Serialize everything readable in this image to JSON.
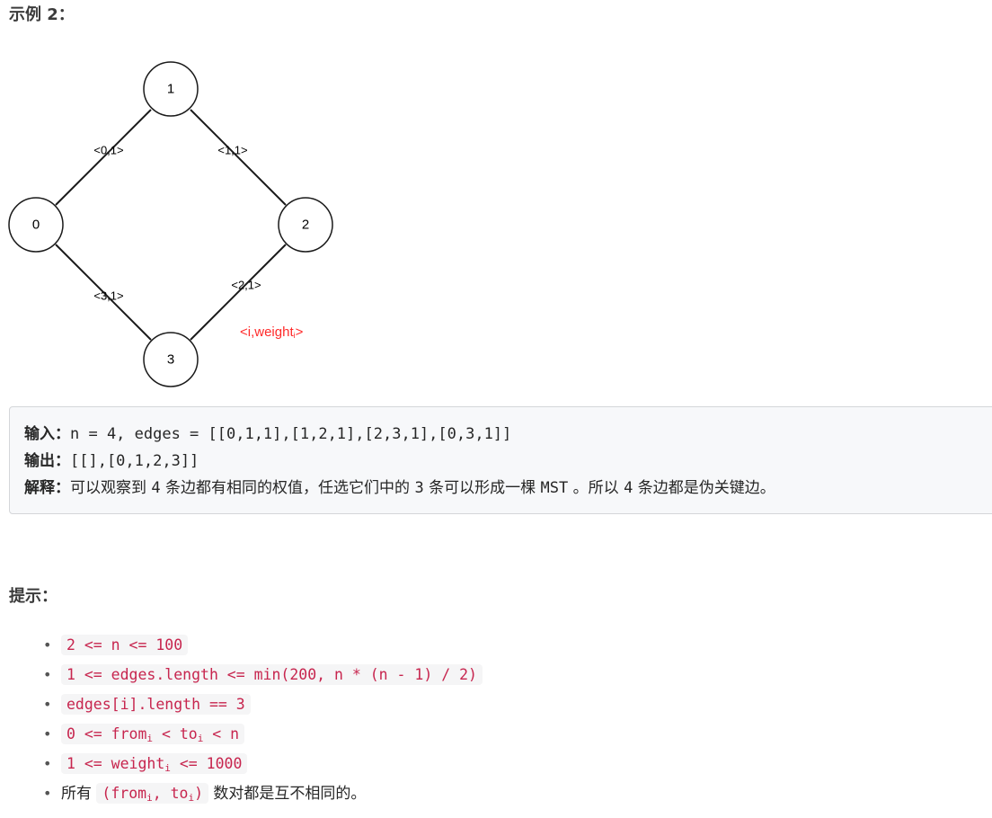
{
  "example_heading": "示例 2：",
  "figure": {
    "nodes": [
      {
        "id": "node-0",
        "label": "0"
      },
      {
        "id": "node-1",
        "label": "1"
      },
      {
        "id": "node-2",
        "label": "2"
      },
      {
        "id": "node-3",
        "label": "3"
      }
    ],
    "edges": [
      {
        "label": "<0,1>"
      },
      {
        "label": "<1,1>"
      },
      {
        "label": "<2,1>"
      },
      {
        "label": "<3,1>"
      }
    ],
    "legend": {
      "prefix": "<i,weight",
      "sub": "i",
      "suffix": ">"
    },
    "legend_color": "#ff2a2a"
  },
  "example": {
    "input_label": "输入：",
    "input_value": "n = 4, edges = [[0,1,1],[1,2,1],[2,3,1],[0,3,1]]",
    "output_label": "输出：",
    "output_value": "[[],[0,1,2,3]]",
    "explanation_label": "解释：",
    "explanation_parts": [
      "可以观察到 ",
      "4",
      " 条边都有相同的权值，任选它们中的 ",
      "3",
      " 条可以形成一棵 ",
      "MST",
      " 。所以 ",
      "4",
      " 条边都是伪关键边。"
    ]
  },
  "hints_heading": "提示：",
  "hints": {
    "h1": "2 <= n <= 100",
    "h2": "1 <= edges.length <= min(200, n * (n - 1) / 2)",
    "h3": "edges[i].length == 3",
    "h4": {
      "a": "0 <= from",
      "sub1": "i",
      "b": " < to",
      "sub2": "i",
      "c": " < n"
    },
    "h5": {
      "a": "1 <= weight",
      "sub1": "i",
      "b": " <= 1000"
    },
    "h6": {
      "prefix": "所有 ",
      "a": "(from",
      "sub1": "i",
      "b": ", to",
      "sub2": "i",
      "c": ")",
      "suffix": " 数对都是互不相同的。"
    }
  },
  "colors": {
    "code_text": "#c7254e",
    "code_bg": "#f5f5f6",
    "example_bg": "#f7f8fa"
  }
}
